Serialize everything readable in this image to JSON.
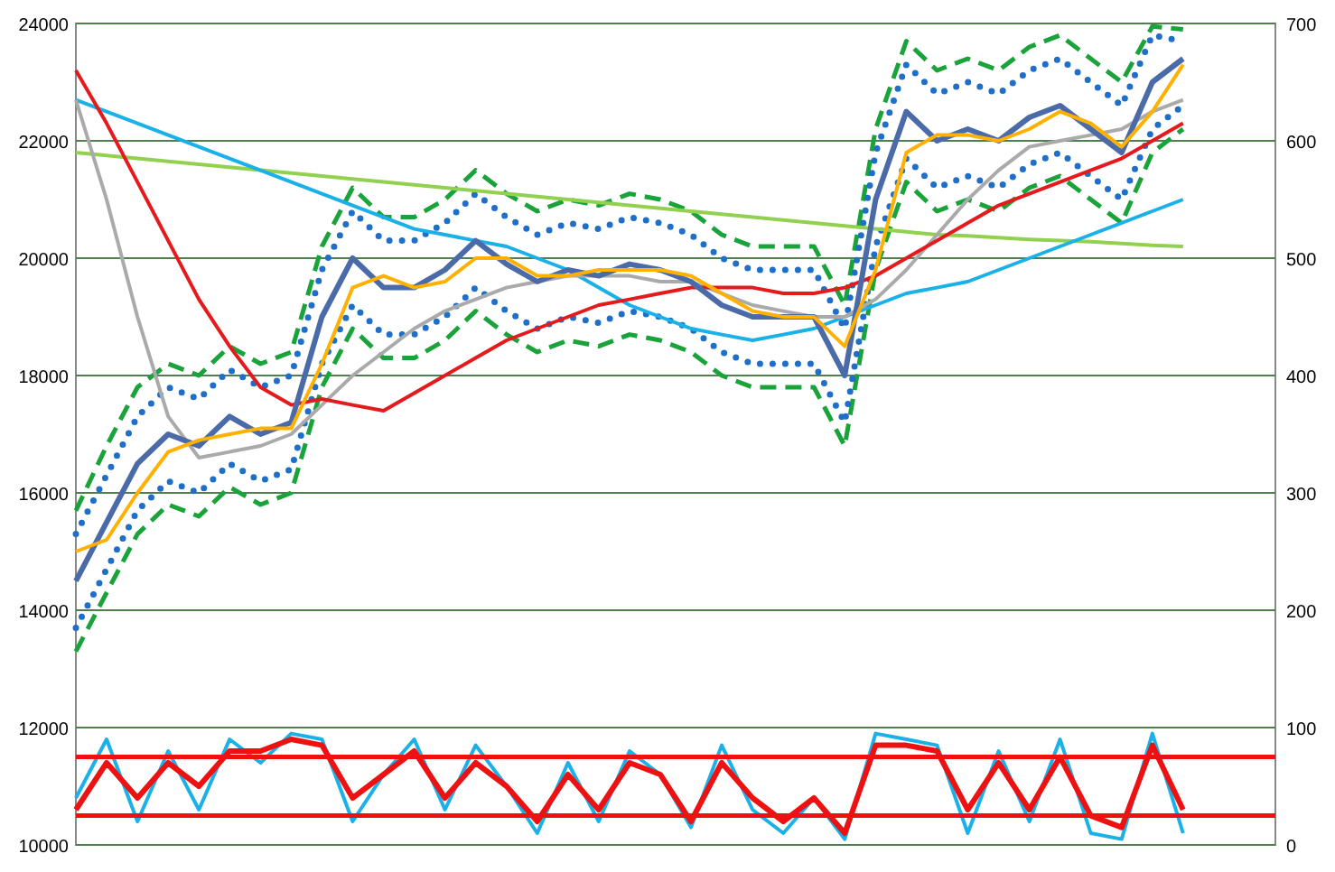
{
  "price_chart": {
    "chart_data": {
      "type": "line",
      "categories": [
        null,
        null,
        null,
        null,
        null,
        null,
        null,
        null,
        null,
        null,
        null,
        null,
        null,
        null,
        null,
        null,
        null,
        null,
        null,
        null,
        null,
        null,
        null,
        null,
        null,
        null,
        null,
        null,
        null,
        null,
        null,
        null,
        null,
        null,
        null,
        null,
        null,
        null,
        null,
        null
      ],
      "ylim": [
        10000,
        24000
      ],
      "grid": true,
      "yticks": [
        10000,
        12000,
        14000,
        16000,
        18000,
        20000,
        22000,
        24000
      ],
      "series": [
        {
          "color": "#1aa33a",
          "line_style": "dashed",
          "values": [
            15700,
            16800,
            17800,
            18200,
            18000,
            18500,
            18200,
            18400,
            20200,
            21200,
            20700,
            20700,
            21000,
            21500,
            21100,
            20800,
            21000,
            20900,
            21100,
            21000,
            20800,
            20400,
            20200,
            20200,
            20200,
            19200,
            22200,
            23700,
            23200,
            23400,
            23200,
            23600,
            23800,
            23400,
            23000,
            23950,
            23900,
            null,
            null,
            null
          ]
        },
        {
          "color": "#1aa33a",
          "line_style": "dashed",
          "values": [
            13300,
            14300,
            15300,
            15800,
            15600,
            16100,
            15800,
            16000,
            17800,
            18800,
            18300,
            18300,
            18600,
            19100,
            18700,
            18400,
            18600,
            18500,
            18700,
            18600,
            18400,
            18000,
            17800,
            17800,
            17800,
            16800,
            19800,
            21300,
            20800,
            21000,
            20800,
            21200,
            21400,
            21000,
            20600,
            21800,
            22200,
            null,
            null,
            null
          ]
        },
        {
          "color": "#1f6fc8",
          "line_style": "dotted",
          "values": [
            15300,
            16300,
            17300,
            17800,
            17600,
            18100,
            17800,
            18000,
            19800,
            20800,
            20300,
            20300,
            20600,
            21100,
            20700,
            20400,
            20600,
            20500,
            20700,
            20600,
            20400,
            20000,
            19800,
            19800,
            19800,
            18800,
            21800,
            23300,
            22800,
            23000,
            22800,
            23200,
            23400,
            23000,
            22600,
            23800,
            23700,
            null,
            null,
            null
          ]
        },
        {
          "color": "#1f6fc8",
          "line_style": "dotted",
          "values": [
            13700,
            14700,
            15700,
            16200,
            16000,
            16500,
            16200,
            16400,
            18200,
            19200,
            18700,
            18700,
            19000,
            19500,
            19100,
            18800,
            19000,
            18900,
            19100,
            19000,
            18800,
            18400,
            18200,
            18200,
            18200,
            17200,
            20200,
            21700,
            21200,
            21400,
            21200,
            21600,
            21800,
            21400,
            21000,
            22200,
            22600,
            null,
            null,
            null
          ]
        },
        {
          "color": "#92d050",
          "values": [
            21800,
            21750,
            21700,
            21650,
            21600,
            21550,
            21500,
            21450,
            21400,
            21350,
            21300,
            21250,
            21200,
            21150,
            21100,
            21050,
            21000,
            20950,
            20900,
            20850,
            20800,
            20750,
            20700,
            20650,
            20600,
            20550,
            20500,
            20450,
            20400,
            20380,
            20350,
            20320,
            20300,
            20280,
            20250,
            20220,
            20200,
            null,
            null,
            null
          ]
        },
        {
          "color": "#1ab0e8",
          "values": [
            22700,
            22500,
            22300,
            22100,
            21900,
            21700,
            21500,
            21300,
            21100,
            20900,
            20700,
            20500,
            20400,
            20300,
            20200,
            20000,
            19800,
            19500,
            19200,
            19000,
            18800,
            18700,
            18600,
            18700,
            18800,
            19000,
            19200,
            19400,
            19500,
            19600,
            19800,
            20000,
            20200,
            20400,
            20600,
            20800,
            21000,
            null,
            null,
            null
          ]
        },
        {
          "color": "#aaaaaa",
          "values": [
            22700,
            21000,
            19000,
            17300,
            16600,
            16700,
            16800,
            17000,
            17500,
            18000,
            18400,
            18800,
            19100,
            19300,
            19500,
            19600,
            19700,
            19700,
            19700,
            19600,
            19600,
            19400,
            19200,
            19100,
            19000,
            19000,
            19300,
            19800,
            20400,
            21000,
            21500,
            21900,
            22000,
            22100,
            22200,
            22500,
            22700,
            null,
            null,
            null
          ]
        },
        {
          "color": "#e41a1c",
          "values": [
            23200,
            22300,
            21300,
            20300,
            19300,
            18500,
            17800,
            17500,
            17600,
            17500,
            17400,
            17700,
            18000,
            18300,
            18600,
            18800,
            19000,
            19200,
            19300,
            19400,
            19500,
            19500,
            19500,
            19400,
            19400,
            19500,
            19700,
            20000,
            20300,
            20600,
            20900,
            21100,
            21300,
            21500,
            21700,
            22000,
            22300,
            null,
            null,
            null
          ]
        },
        {
          "color": "#4a6aa8",
          "values": [
            14500,
            15500,
            16500,
            17000,
            16800,
            17300,
            17000,
            17200,
            19000,
            20000,
            19500,
            19500,
            19800,
            20300,
            19900,
            19600,
            19800,
            19700,
            19900,
            19800,
            19600,
            19200,
            19000,
            19000,
            19000,
            18000,
            21000,
            22500,
            22000,
            22200,
            22000,
            22400,
            22600,
            22200,
            21800,
            23000,
            23400,
            null,
            null,
            null
          ]
        },
        {
          "color": "#ffb000",
          "values": [
            15000,
            15200,
            16000,
            16700,
            16900,
            17000,
            17100,
            17100,
            18200,
            19500,
            19700,
            19500,
            19600,
            20000,
            20000,
            19700,
            19700,
            19800,
            19800,
            19800,
            19700,
            19400,
            19100,
            19000,
            19000,
            18500,
            19800,
            21800,
            22100,
            22100,
            22000,
            22200,
            22500,
            22300,
            21900,
            22500,
            23300,
            null,
            null,
            null
          ]
        }
      ]
    }
  },
  "oscillator_chart": {
    "chart_data": {
      "type": "line",
      "categories": [
        null,
        null,
        null,
        null,
        null,
        null,
        null,
        null,
        null,
        null,
        null,
        null,
        null,
        null,
        null,
        null,
        null,
        null,
        null,
        null,
        null,
        null,
        null,
        null,
        null,
        null,
        null,
        null,
        null,
        null,
        null,
        null,
        null,
        null,
        null,
        null,
        null,
        null,
        null,
        null
      ],
      "ylim": [
        0,
        700
      ],
      "yticks": [
        0,
        100,
        200,
        300,
        400,
        500,
        600,
        700
      ],
      "series": [
        {
          "color": "#1ab0e8",
          "values": [
            40,
            90,
            20,
            80,
            30,
            90,
            70,
            95,
            90,
            20,
            60,
            90,
            30,
            85,
            50,
            10,
            70,
            20,
            80,
            60,
            15,
            85,
            30,
            10,
            40,
            5,
            95,
            90,
            85,
            10,
            80,
            20,
            90,
            10,
            5,
            95,
            10,
            null,
            null,
            null
          ]
        },
        {
          "color": "#ee1111",
          "values": [
            30,
            70,
            40,
            70,
            50,
            80,
            80,
            90,
            85,
            40,
            60,
            80,
            40,
            70,
            50,
            20,
            60,
            30,
            70,
            60,
            20,
            70,
            40,
            20,
            40,
            10,
            85,
            85,
            80,
            30,
            70,
            30,
            75,
            25,
            15,
            85,
            30,
            null,
            null,
            null
          ]
        },
        {
          "color": "#ee1111",
          "values": [
            75,
            75,
            75,
            75,
            75,
            75,
            75,
            75,
            75,
            75,
            75,
            75,
            75,
            75,
            75,
            75,
            75,
            75,
            75,
            75,
            75,
            75,
            75,
            75,
            75,
            75,
            75,
            75,
            75,
            75,
            75,
            75,
            75,
            75,
            75,
            75,
            75,
            75,
            75,
            75
          ]
        },
        {
          "color": "#ee1111",
          "values": [
            25,
            25,
            25,
            25,
            25,
            25,
            25,
            25,
            25,
            25,
            25,
            25,
            25,
            25,
            25,
            25,
            25,
            25,
            25,
            25,
            25,
            25,
            25,
            25,
            25,
            25,
            25,
            25,
            25,
            25,
            25,
            25,
            25,
            25,
            25,
            25,
            25,
            25,
            25,
            25
          ]
        }
      ]
    }
  }
}
